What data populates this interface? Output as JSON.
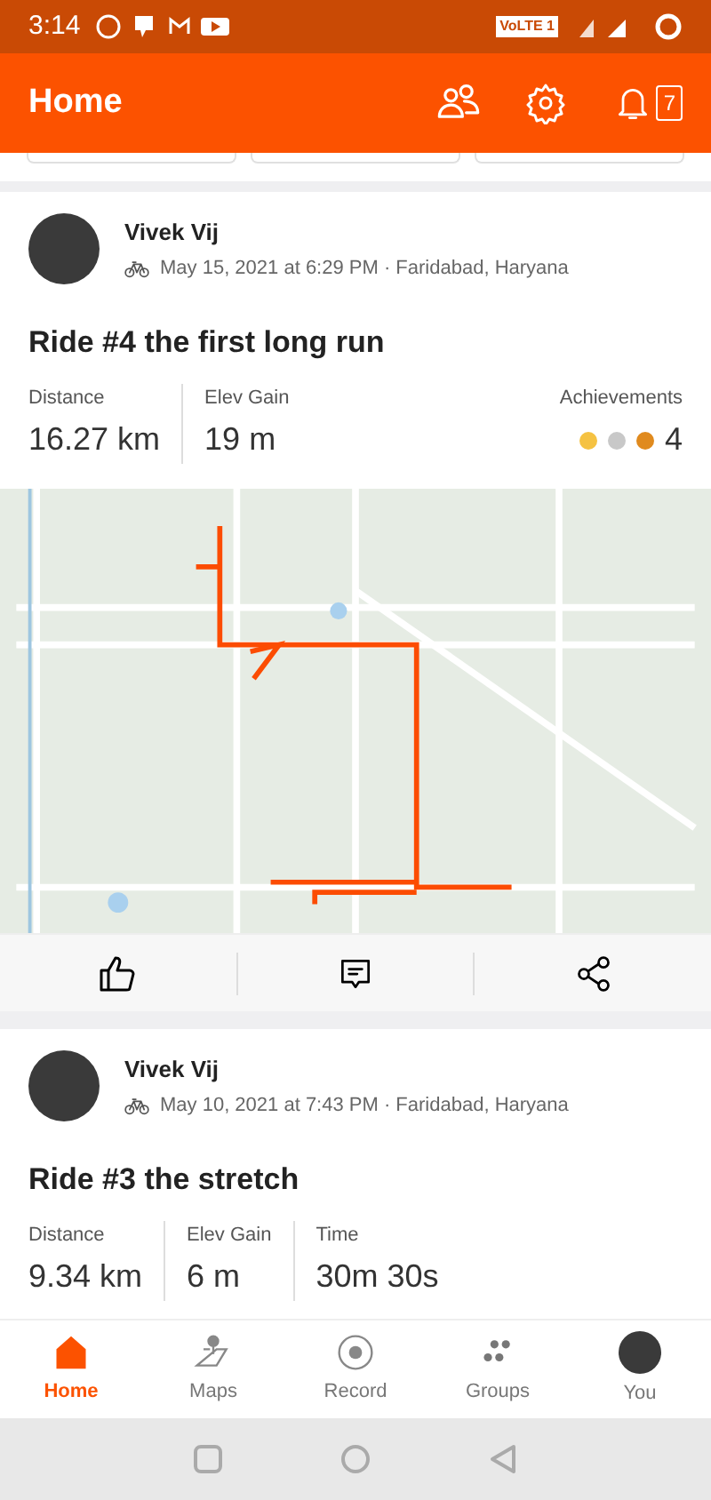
{
  "status_bar": {
    "time": "3:14",
    "network": "VoLTE 1"
  },
  "header": {
    "title": "Home",
    "notifications": "7"
  },
  "activities": [
    {
      "athlete": "Vivek Vij",
      "meta": "May 15, 2021 at 6:29 PM · Faridabad, Haryana",
      "title": "Ride #4 the first long run",
      "stats": [
        {
          "label": "Distance",
          "value": "16.27 km"
        },
        {
          "label": "Elev Gain",
          "value": "19 m"
        }
      ],
      "achievements": {
        "label": "Achievements",
        "count": "4",
        "medals": [
          {
            "color": "#f5c242"
          },
          {
            "color": "#c8c8c8"
          },
          {
            "color": "#e08a1e"
          }
        ]
      },
      "map": true
    },
    {
      "athlete": "Vivek Vij",
      "meta": "May 10, 2021 at 7:43 PM · Faridabad, Haryana",
      "title": "Ride #3 the stretch",
      "stats": [
        {
          "label": "Distance",
          "value": "9.34 km"
        },
        {
          "label": "Elev Gain",
          "value": "6 m"
        },
        {
          "label": "Time",
          "value": "30m 30s"
        }
      ]
    }
  ],
  "nav": [
    {
      "label": "Home",
      "kind": "home",
      "selected": true
    },
    {
      "label": "Maps",
      "kind": "maps",
      "selected": false
    },
    {
      "label": "Record",
      "kind": "record",
      "selected": false
    },
    {
      "label": "Groups",
      "kind": "groups",
      "selected": false
    },
    {
      "label": "You",
      "kind": "you",
      "selected": false
    }
  ]
}
